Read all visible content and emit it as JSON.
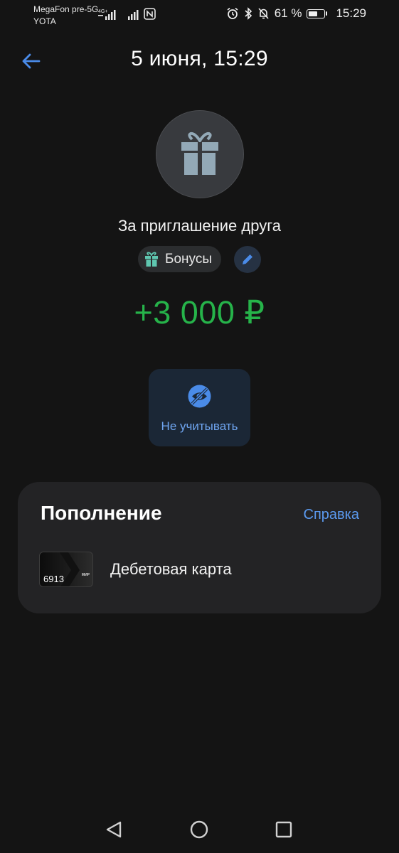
{
  "status_bar": {
    "carrier_1": "MegaFon pre-5G",
    "carrier_2": "YOTA",
    "network_badge": "4G+",
    "battery_percent": "61 %",
    "battery_level": 0.61,
    "time": "15:29"
  },
  "header": {
    "title": "5 июня, 15:29",
    "back_icon": "arrow-left-icon"
  },
  "transaction": {
    "icon": "gift-icon",
    "name": "За приглашение друга",
    "category": {
      "label": "Бонусы",
      "icon": "gift-small-icon",
      "color": "#5fc7b0"
    },
    "edit_icon": "pencil-icon",
    "amount": "+3 000 ₽",
    "amount_color": "#26b34a"
  },
  "actions": {
    "ignore": {
      "label": "Не учитывать",
      "icon": "eye-off-icon"
    }
  },
  "panel": {
    "title": "Пополнение",
    "help_link": "Справка",
    "card": {
      "number": "6913",
      "brand": "МИР",
      "label": "Дебетовая карта"
    }
  },
  "colors": {
    "background": "#141414",
    "accent": "#5b9af0",
    "panel": "#232325"
  }
}
